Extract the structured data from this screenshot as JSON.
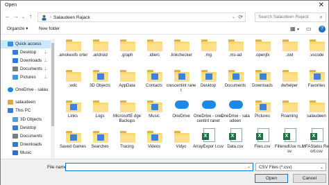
{
  "window": {
    "title": "Open",
    "close_glyph": "✕"
  },
  "nav": {
    "back": "←",
    "forward": "→",
    "history": "⌄",
    "up": "↑"
  },
  "address": {
    "path": "Salaudeen Rajack",
    "separator": "›",
    "chevron": "⌄",
    "refresh": "⟳"
  },
  "search": {
    "placeholder": "Search Salaudeen Rajack",
    "icon": "⌕"
  },
  "cmdbar": {
    "organize": "Organize ▾",
    "new_folder": "New folder",
    "view_icon": "▦",
    "view_chevron": "▾",
    "pane_icon": "▭",
    "help_icon": "?"
  },
  "sidebar": {
    "items": [
      {
        "label": "Quick access",
        "icon": "star-icon",
        "pinned": false,
        "selected": true,
        "indent": 0
      },
      {
        "label": "Desktop",
        "icon": "desktop-icon",
        "pinned": true,
        "indent": 1
      },
      {
        "label": "Downloads",
        "icon": "download-icon",
        "pinned": true,
        "indent": 1
      },
      {
        "label": "Documents",
        "icon": "documents-icon",
        "pinned": true,
        "indent": 1
      },
      {
        "label": "Pictures",
        "icon": "pictures-icon",
        "pinned": true,
        "indent": 1
      },
      {
        "label": "OneDrive - salau",
        "icon": "cloud-icon",
        "pinned": false,
        "indent": 0
      },
      {
        "label": "salaudeen",
        "icon": "user-icon",
        "pinned": false,
        "indent": 0
      },
      {
        "label": "This PC",
        "icon": "pc-icon",
        "pinned": false,
        "indent": 0
      },
      {
        "label": "3D Objects",
        "icon": "cube-icon",
        "pinned": false,
        "indent": 1
      },
      {
        "label": "Desktop",
        "icon": "desktop-icon",
        "pinned": false,
        "indent": 1
      },
      {
        "label": "Documents",
        "icon": "documents-icon",
        "pinned": false,
        "indent": 1
      },
      {
        "label": "Downloads",
        "icon": "download-icon",
        "pinned": false,
        "indent": 1
      },
      {
        "label": "Music",
        "icon": "music-icon",
        "pinned": false,
        "indent": 1
      }
    ],
    "pin_glyph": "📌"
  },
  "files": [
    {
      "name": ".amokexifs orter",
      "type": "folder"
    },
    {
      "name": ".android",
      "type": "folder"
    },
    {
      "name": ".graph",
      "type": "folder"
    },
    {
      "name": ".idlerc",
      "type": "folder"
    },
    {
      "name": ".linkchecker",
      "type": "folder"
    },
    {
      "name": ".mg",
      "type": "folder"
    },
    {
      "name": ".ms-ad",
      "type": "folder"
    },
    {
      "name": ".openjfx",
      "type": "folder"
    },
    {
      "name": ".swt",
      "type": "folder"
    },
    {
      "name": ".vscode",
      "type": "folder"
    },
    {
      "name": ".wdc",
      "type": "folder"
    },
    {
      "name": "3D Objects",
      "type": "special-folder"
    },
    {
      "name": "AppData",
      "type": "folder"
    },
    {
      "name": "Contacts",
      "type": "special-folder"
    },
    {
      "name": "crescentint ranet",
      "type": "special-folder"
    },
    {
      "name": "Desktop",
      "type": "special-folder"
    },
    {
      "name": "Documents",
      "type": "special-folder"
    },
    {
      "name": "Downloads",
      "type": "special-folder"
    },
    {
      "name": "dwhelper",
      "type": "folder"
    },
    {
      "name": "Favorites",
      "type": "special-folder"
    },
    {
      "name": "Links",
      "type": "special-folder"
    },
    {
      "name": "Logs",
      "type": "folder"
    },
    {
      "name": "MicrosoftE dgeBackups",
      "type": "folder"
    },
    {
      "name": "Music",
      "type": "special-folder"
    },
    {
      "name": "OneDrive",
      "type": "cloud"
    },
    {
      "name": "OneDrive - crescentint ranet",
      "type": "cloud"
    },
    {
      "name": "OneDrive - salaudeen",
      "type": "cloud"
    },
    {
      "name": "Pictures",
      "type": "special-folder"
    },
    {
      "name": "Roaming",
      "type": "folder"
    },
    {
      "name": "salaudeen",
      "type": "folder"
    },
    {
      "name": "Saved Games",
      "type": "special-folder"
    },
    {
      "name": "Searches",
      "type": "special-folder"
    },
    {
      "name": "Tracing",
      "type": "folder"
    },
    {
      "name": "Videos",
      "type": "special-folder"
    },
    {
      "name": "Vidyo",
      "type": "folder"
    },
    {
      "name": "ArrayExpor t.csv",
      "type": "csv"
    },
    {
      "name": "Data.csv",
      "type": "csv"
    },
    {
      "name": "Files.csv",
      "type": "csv"
    },
    {
      "name": "FilteredUse rs.csv",
      "type": "csv"
    },
    {
      "name": "MFAStatus Report.csv",
      "type": "csv"
    }
  ],
  "bottom": {
    "file_name_label": "File name:",
    "file_name_value": "",
    "file_type": "CSV Files (*.csv)",
    "open_button": "Open",
    "cancel_button": "Cancel",
    "chevron": "⌄"
  },
  "colors": {
    "selection": "#cce8ff",
    "accent": "#0078d7",
    "folder": "#f8d775"
  }
}
